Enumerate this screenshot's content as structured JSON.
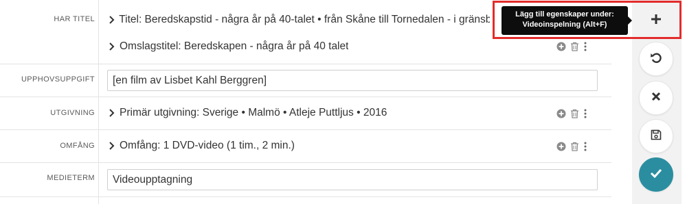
{
  "fields": {
    "har_titel": {
      "label": "HAR TITEL",
      "items": [
        "Titel: Beredskapstid - några år på 40-talet • från Skåne till Tornedalen - i gränsbygd",
        "Omslagstitel: Beredskapen - några år på 40 talet"
      ]
    },
    "upphovsuppgift": {
      "label": "UPPHOVSUPPGIFT",
      "value": "[en film av Lisbet Kahl Berggren]"
    },
    "utgivning": {
      "label": "UTGIVNING",
      "items": [
        "Primär utgivning: Sverige • Malmö • Atleje Puttljus • 2016"
      ]
    },
    "omfang": {
      "label": "OMFÅNG",
      "items": [
        "Omfång: 1 DVD-video (1 tim., 2 min.)"
      ]
    },
    "medieterm": {
      "label": "MEDIETERM",
      "value": "Videoupptagning"
    }
  },
  "tooltip": {
    "line1": "Lägg till egenskaper under:",
    "line2": "Videoinspelning (Alt+F)"
  },
  "toolbar": {
    "buttons": [
      "add-properties",
      "revert",
      "cancel",
      "save",
      "confirm"
    ]
  },
  "colors": {
    "accent": "#2b8ea0",
    "highlight": "#e32b2b",
    "tooltip_bg": "#0d0d0d",
    "icon_gray": "#8a8a8a"
  },
  "icons": {
    "row_actions": [
      "plus-circle-icon",
      "trash-icon",
      "more-vertical-icon"
    ],
    "expand": "chevron-right-icon"
  }
}
